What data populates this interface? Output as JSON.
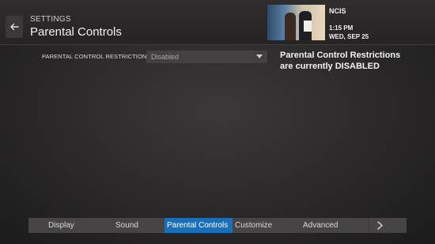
{
  "header": {
    "breadcrumb": "SETTINGS",
    "title": "Parental Controls",
    "back_icon": "arrow-left-icon"
  },
  "now_playing": {
    "show": "NCIS",
    "time": "1:15 PM",
    "date": "WED, SEP 25"
  },
  "restrictions": {
    "label": "PARENTAL CONTROL RESTRICTIONS",
    "selected": "Disabled",
    "status_line1": "Parental Control Restrictions",
    "status_line2": "are currently DISABLED"
  },
  "tabs": [
    {
      "label": "Display"
    },
    {
      "label": "Sound"
    },
    {
      "label": "Parental Controls",
      "active": true
    },
    {
      "label": "Customize"
    },
    {
      "label": "Advanced"
    }
  ],
  "colors": {
    "accent": "#1a6fb8",
    "background": "#2a2828",
    "tabbar": "#464444"
  }
}
